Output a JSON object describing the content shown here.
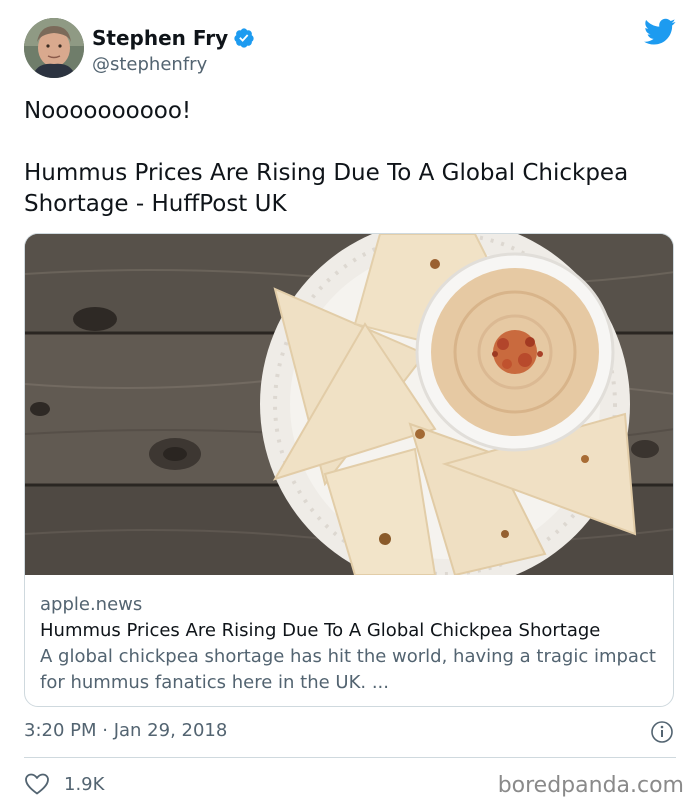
{
  "author": {
    "display_name": "Stephen Fry",
    "handle": "@stephenfry"
  },
  "tweet": {
    "line1": "Noooooooooo!",
    "line2": "Hummus Prices Are Rising Due To A Global Chickpea Shortage - HuffPost UK"
  },
  "card": {
    "domain": "apple.news",
    "title": "Hummus Prices Are Rising Due To A Global Chickpea Shortage",
    "description": "A global chickpea shortage has hit the world, having a tragic impact for hummus fanatics here in the UK. ..."
  },
  "meta": {
    "timestamp": "3:20 PM · Jan 29, 2018",
    "likes": "1.9K"
  },
  "watermark": "boredpanda.com",
  "icons": {
    "verified": "verified-badge-icon",
    "bird": "twitter-bird-icon",
    "info": "info-icon",
    "heart": "heart-icon"
  },
  "colors": {
    "twitter_blue": "#1d9bf0",
    "text_primary": "#0f1419",
    "text_secondary": "#536471"
  }
}
